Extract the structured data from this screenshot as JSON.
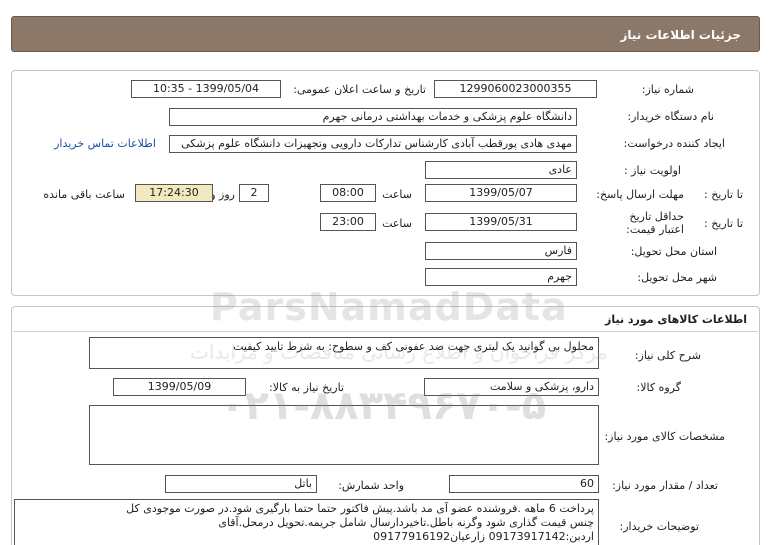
{
  "header": {
    "title": "جزئیات اطلاعات نیاز"
  },
  "need_info": {
    "need_number_label": "شماره نیاز:",
    "need_number": "1299060023000355",
    "announce_label": "تاریخ و ساعت اعلان عمومی:",
    "announce_value": "1399/05/04 - 10:35",
    "buyer_org_label": "نام دستگاه خریدار:",
    "buyer_org": "دانشگاه علوم پزشکی و خدمات بهداشتی درمانی جهرم",
    "creator_label": "ایجاد کننده درخواست:",
    "creator": "مهدی هادی پورقطب آبادی کارشناس تدارکات دارویی وتجهیزات دانشگاه علوم پزشکی",
    "contact_link": "اطلاعات تماس خریدار",
    "priority_label": "اولویت نیاز :",
    "priority": "عادی",
    "reply_deadline_label": "مهلت ارسال پاسخ:",
    "to_date_label": "تا تاریخ :",
    "reply_date": "1399/05/07",
    "time_label": "ساعت",
    "reply_time": "08:00",
    "days_value": "2",
    "days_label": "روز و",
    "remaining_time": "17:24:30",
    "remaining_label": "ساعت باقی مانده",
    "price_validity_label": "حداقل تاریخ اعتبار قیمت:",
    "validity_date": "1399/05/31",
    "validity_time": "23:00",
    "province_label": "استان محل تحویل:",
    "province": "فارس",
    "city_label": "شهر محل تحویل:",
    "city": "جهرم"
  },
  "goods": {
    "section_title": "اطلاعات کالاهای مورد نیاز",
    "description_label": "شرح کلی نیاز:",
    "description": "محلول بی گوانید یک لیتری جهت ضد عفونی کف و سطوح: به شرط تایید کیفیت",
    "group_label": "گروه کالا:",
    "group": "دارو، پزشکی و سلامت",
    "need_date_label": "تاریخ نیاز به کالا:",
    "need_date": "1399/05/09",
    "specs_label": "مشخصات کالای مورد نیاز:",
    "specs": "",
    "quantity_label": "تعداد / مقدار مورد نیاز:",
    "quantity": "60",
    "unit_label": "واحد شمارش:",
    "unit": "باتل",
    "buyer_notes_label": "توضیحات خریدار:",
    "buyer_notes_1": "پرداخت 6 ماهه .فروشنده عضو آی مد باشد.پیش فاکتور حتما حتما بارگیری شود.در صورت موجودی کل",
    "buyer_notes_2": "چنس قیمت گذاری شود وگرنه باطل.تاخیردارسال شامل جریمه.تحویل درمحل.آقای",
    "buyer_notes_3": "اردبن:09173917142 زارعیان09177916192"
  },
  "watermark": {
    "brand": "ParsNamadData",
    "tagline": "مرکز فراخوان و اطلاع رسانی مناقصات و مزایدات",
    "phone": "۰۲۱-۸۸۳۴۹۶۷۰-۵"
  }
}
